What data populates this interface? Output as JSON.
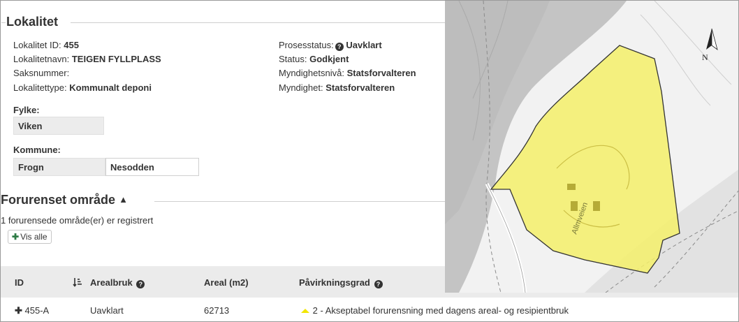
{
  "lokalitet": {
    "title": "Lokalitet",
    "id_label": "Lokalitet ID:",
    "id_value": "455",
    "navn_label": "Lokalitetnavn:",
    "navn_value": "TEIGEN FYLLPLASS",
    "saksnummer_label": "Saksnummer:",
    "type_label": "Lokalitettype:",
    "type_value": "Kommunalt deponi",
    "prosess_label": "Prosesstatus:",
    "prosess_value": "Uavklart",
    "status_label": "Status:",
    "status_value": "Godkjent",
    "myndighetsniva_label": "Myndighetsnivå:",
    "myndighetsniva_value": "Statsforvalteren",
    "myndighet_label": "Myndighet:",
    "myndighet_value": "Statsforvalteren",
    "fylke_label": "Fylke:",
    "fylke_value": "Viken",
    "kommune_label": "Kommune:",
    "kommune_values": [
      "Frogn",
      "Nesodden"
    ]
  },
  "forurenset": {
    "title": "Forurenset område",
    "count_text": "1 forurensede område(er) er registrert",
    "vis_alle_label": "Vis alle",
    "columns": [
      "ID",
      "Arealbruk",
      "Areal (m2)",
      "Påvirkningsgrad"
    ],
    "rows": [
      {
        "id": "455-A",
        "arealbruk": "Uavklart",
        "areal": "62713",
        "pavirkningsgrad": "2 - Akseptabel forurensning med dagens areal- og resipientbruk"
      }
    ]
  },
  "map": {
    "north_label": "N",
    "road_label": "Allmveien",
    "polygon_color": "#f5f06a"
  }
}
